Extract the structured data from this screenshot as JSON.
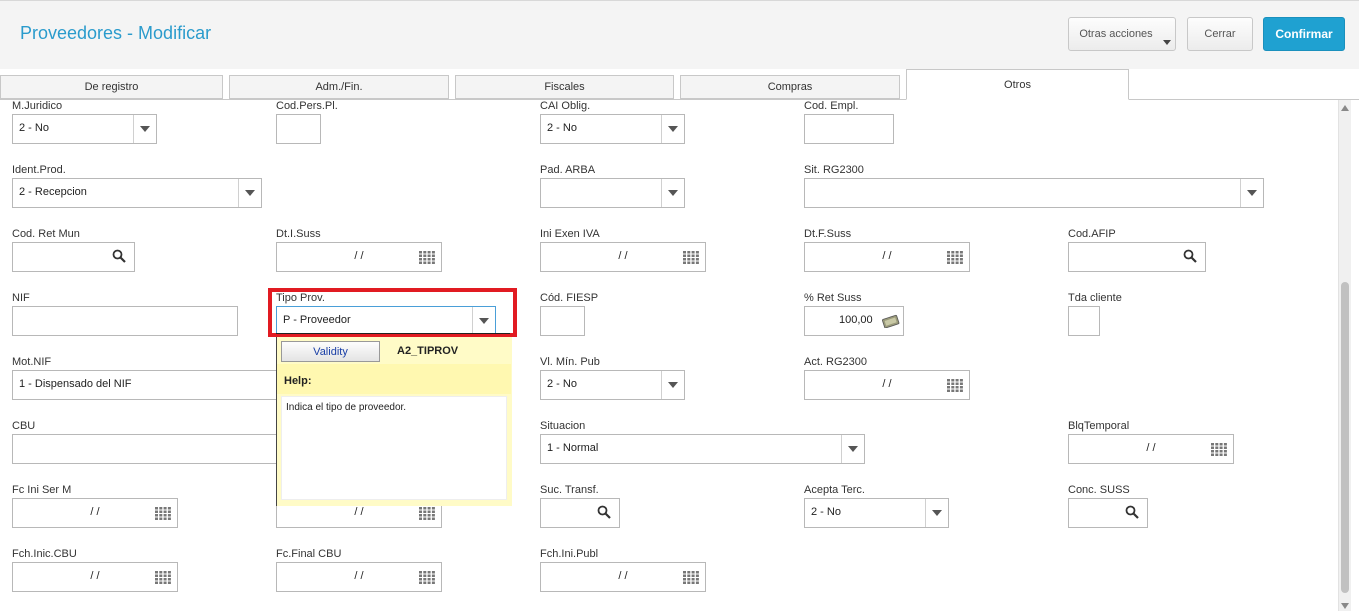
{
  "header": {
    "title": "Proveedores - Modificar",
    "more_actions_label": "Otras acciones",
    "close_label": "Cerrar",
    "confirm_label": "Confirmar"
  },
  "tabs": [
    "De registro",
    "Adm./Fin.",
    "Fiscales",
    "Compras",
    "Otros"
  ],
  "active_tab": "Otros",
  "fields": {
    "m_juridico": {
      "label": "M.Juridico",
      "value": "2 - No"
    },
    "cod_pers_pl": {
      "label": "Cod.Pers.Pl.",
      "value": ""
    },
    "cai_oblig": {
      "label": "CAI Oblig.",
      "value": "2 - No"
    },
    "cod_empl": {
      "label": "Cod. Empl.",
      "value": ""
    },
    "ident_prod": {
      "label": "Ident.Prod.",
      "value": "2 - Recepcion"
    },
    "pad_arba": {
      "label": "Pad. ARBA",
      "value": ""
    },
    "sit_rg2300": {
      "label": "Sit. RG2300",
      "value": ""
    },
    "cod_ret_mun": {
      "label": "Cod. Ret Mun",
      "value": ""
    },
    "dt_i_suss": {
      "label": "Dt.I.Suss",
      "value": "/ /"
    },
    "ini_exen_iva": {
      "label": "Ini Exen IVA",
      "value": "/ /"
    },
    "dt_f_suss": {
      "label": "Dt.F.Suss",
      "value": "/ /"
    },
    "cod_afip": {
      "label": "Cod.AFIP",
      "value": ""
    },
    "nif": {
      "label": "NIF",
      "value": ""
    },
    "tipo_prov": {
      "label": "Tipo Prov.",
      "value": "P - Proveedor"
    },
    "cod_fiesp": {
      "label": "Cód. FIESP",
      "value": ""
    },
    "ret_suss": {
      "label": "% Ret Suss",
      "value": "100,00"
    },
    "tda_cliente": {
      "label": "Tda cliente",
      "value": ""
    },
    "mot_nif": {
      "label": "Mot.NIF",
      "value": "1 - Dispensado del NIF"
    },
    "vl_min_pub": {
      "label": "Vl. Mín. Pub",
      "value": "2 - No"
    },
    "act_rg2300": {
      "label": "Act. RG2300",
      "value": "/ /"
    },
    "cbu": {
      "label": "CBU",
      "value": ""
    },
    "situacion": {
      "label": "Situacion",
      "value": "1 - Normal"
    },
    "blq_temporal": {
      "label": "BlqTemporal",
      "value": "/ /"
    },
    "fc_ini_ser_m": {
      "label": "Fc Ini Ser M",
      "value": "/ /"
    },
    "hidden_date": {
      "value": "/ /"
    },
    "suc_transf": {
      "label": "Suc. Transf.",
      "value": ""
    },
    "acepta_terc": {
      "label": "Acepta Terc.",
      "value": "2 - No"
    },
    "conc_suss": {
      "label": "Conc. SUSS",
      "value": ""
    },
    "fch_inic_cbu": {
      "label": "Fch.Inic.CBU",
      "value": "/ /"
    },
    "fc_final_cbu": {
      "label": "Fc.Final CBU",
      "value": "/ /"
    },
    "fch_ini_publ": {
      "label": "Fch.Ini.Publ",
      "value": "/ /"
    }
  },
  "help_popup": {
    "validity_label": "Validity",
    "field_name": "A2_TIPROV",
    "help_label": "Help:",
    "help_text": "Indica el tipo de proveedor."
  },
  "colors": {
    "accent": "#2a9bcc",
    "primary_button": "#1fa1d1",
    "highlight_frame": "#e11b22",
    "help_background": "#fffbc7"
  }
}
